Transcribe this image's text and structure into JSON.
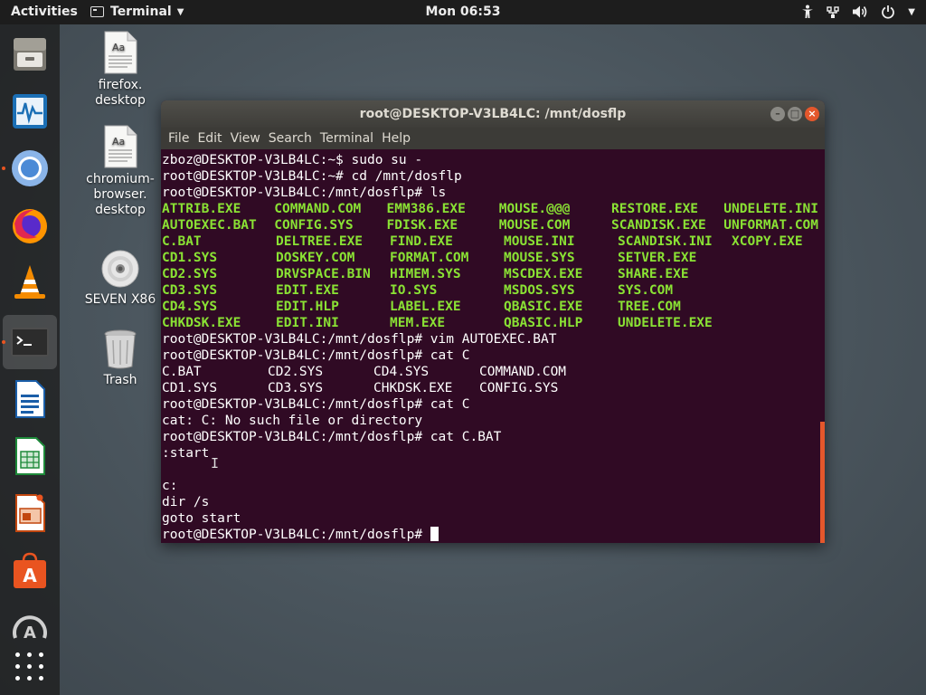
{
  "topbar": {
    "activities": "Activities",
    "app_name": "Terminal",
    "clock": "Mon 06:53",
    "tray_icons": [
      "accessibility-icon",
      "network-icon",
      "volume-icon",
      "power-icon"
    ]
  },
  "dock": {
    "items": [
      {
        "name": "files",
        "icon": "file-cabinet-icon"
      },
      {
        "name": "system-monitor",
        "icon": "monitor-icon"
      },
      {
        "name": "chromium",
        "icon": "chromium-icon",
        "running": true
      },
      {
        "name": "firefox",
        "icon": "firefox-icon"
      },
      {
        "name": "vlc",
        "icon": "vlc-cone-icon"
      },
      {
        "name": "terminal",
        "icon": "terminal-icon",
        "running": true,
        "active": true
      },
      {
        "name": "libreoffice-writer",
        "icon": "writer-icon"
      },
      {
        "name": "libreoffice-calc",
        "icon": "calc-icon"
      },
      {
        "name": "libreoffice-impress",
        "icon": "impress-icon"
      },
      {
        "name": "software",
        "icon": "software-bag-icon"
      },
      {
        "name": "software-updater",
        "icon": "updater-icon"
      }
    ],
    "show_apps_icon": "app-grid-icon"
  },
  "desktop": {
    "icons": [
      {
        "label": "firefox.\ndesktop",
        "icon": "text-file-icon"
      },
      {
        "label": "chromium-\nbrowser.\ndesktop",
        "icon": "text-file-icon"
      },
      {
        "label": "SEVEN X86",
        "icon": "disc-icon"
      },
      {
        "label": "Trash",
        "icon": "trash-icon"
      }
    ]
  },
  "terminal": {
    "title": "root@DESKTOP-V3LB4LC: /mnt/dosflp",
    "menu": [
      "File",
      "Edit",
      "View",
      "Search",
      "Terminal",
      "Help"
    ],
    "lines_top": [
      "zboz@DESKTOP-V3LB4LC:~$ sudo su -",
      "root@DESKTOP-V3LB4LC:~# cd /mnt/dosflp",
      "root@DESKTOP-V3LB4LC:/mnt/dosflp# ls"
    ],
    "ls_rows": [
      [
        "ATTRIB.EXE",
        "COMMAND.COM",
        "EMM386.EXE",
        "MOUSE.@@@",
        "RESTORE.EXE",
        "UNDELETE.INI"
      ],
      [
        "AUTOEXEC.BAT",
        "CONFIG.SYS",
        "FDISK.EXE",
        "MOUSE.COM",
        "SCANDISK.EXE",
        "UNFORMAT.COM"
      ],
      [
        "C.BAT",
        "DELTREE.EXE",
        "FIND.EXE",
        "MOUSE.INI",
        "SCANDISK.INI",
        "XCOPY.EXE"
      ],
      [
        "CD1.SYS",
        "DOSKEY.COM",
        "FORMAT.COM",
        "MOUSE.SYS",
        "SETVER.EXE",
        ""
      ],
      [
        "CD2.SYS",
        "DRVSPACE.BIN",
        "HIMEM.SYS",
        "MSCDEX.EXE",
        "SHARE.EXE",
        ""
      ],
      [
        "CD3.SYS",
        "EDIT.EXE",
        "IO.SYS",
        "MSDOS.SYS",
        "SYS.COM",
        ""
      ],
      [
        "CD4.SYS",
        "EDIT.HLP",
        "LABEL.EXE",
        "QBASIC.EXE",
        "TREE.COM",
        ""
      ],
      [
        "CHKDSK.EXE",
        "EDIT.INI",
        "MEM.EXE",
        "QBASIC.HLP",
        "UNDELETE.EXE",
        ""
      ]
    ],
    "lines_mid": [
      "root@DESKTOP-V3LB4LC:/mnt/dosflp# vim AUTOEXEC.BAT",
      "root@DESKTOP-V3LB4LC:/mnt/dosflp# cat C"
    ],
    "completion_rows": [
      [
        "C.BAT",
        "CD2.SYS",
        "CD4.SYS",
        "COMMAND.COM"
      ],
      [
        "CD1.SYS",
        "CD3.SYS",
        "CHKDSK.EXE",
        "CONFIG.SYS"
      ]
    ],
    "lines_bottom": [
      "root@DESKTOP-V3LB4LC:/mnt/dosflp# cat C",
      "cat: C: No such file or directory",
      "root@DESKTOP-V3LB4LC:/mnt/dosflp# cat C.BAT",
      ":start",
      "",
      "c:",
      "dir /s",
      "goto start"
    ],
    "prompt": "root@DESKTOP-V3LB4LC:/mnt/dosflp# "
  },
  "colors": {
    "terminal_bg": "#300a24",
    "ls_green": "#8ae234",
    "accent": "#e95420"
  }
}
